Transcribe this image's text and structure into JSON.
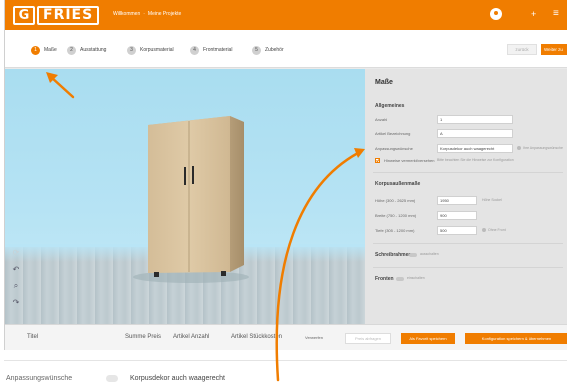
{
  "colors": {
    "accent": "#f07d00",
    "sky": "#b6e3f4",
    "floor": "#c3cfd4",
    "wood": "#dcc8a8"
  },
  "header": {
    "brand": "FRIES",
    "breadcrumb": [
      "Willkommen",
      "Meine Projekte"
    ],
    "icons": [
      "logo-icon",
      "avatar-icon",
      "plus-icon",
      "menu-icon"
    ]
  },
  "steps": [
    {
      "num": "1",
      "label": "Maße",
      "active": true
    },
    {
      "num": "2",
      "label": "Ausstattung",
      "active": false
    },
    {
      "num": "3",
      "label": "Korpusmaterial",
      "active": false
    },
    {
      "num": "4",
      "label": "Frontmaterial",
      "active": false
    },
    {
      "num": "5",
      "label": "Zubehör",
      "active": false
    }
  ],
  "nav": {
    "back_label": "zurück",
    "next_label": "Weiter zu"
  },
  "viewport_tools": [
    "rotate-icon",
    "undo-icon",
    "zoom-icon",
    "redo-icon"
  ],
  "panel": {
    "title": "Maße",
    "general": {
      "title": "Allgemeines",
      "anzahl_label": "Anzahl",
      "anzahl_value": "1",
      "artikel_label": "Artikel Bezeichnung",
      "artikel_value": "A",
      "anpassung_label": "Anpassungswünsche",
      "anpassung_value": "Korpusdekor auch waagerecht",
      "anpassung_hint": "Ihre Anpassungswünsche",
      "check_label": "Hinweise vermerkt/versehen",
      "check_hint": "Bitte beachten Sie die Hinweise zur Konfiguration"
    },
    "korpus": {
      "title": "Korpusaußenmaße",
      "hoehe_label": "Höhe (300 - 2625 mm)",
      "hoehe_value": "1950",
      "hoehe_hint": "Höhe Sockel",
      "breite_label": "Breite (750 - 1200 mm)",
      "breite_value": "900",
      "tiefe_label": "Tiefe (305 - 1200 mm)",
      "tiefe_value": "500",
      "tiefe_hint": "Ohne Front"
    },
    "schreibrahmen_label": "Schreibrahmen",
    "schreibrahmen_hint": "ausschalten",
    "fronten_label": "Fronten",
    "fronten_hint": "einschalten"
  },
  "footer": {
    "titel": "Titel",
    "summe": "Summe Preis",
    "anzahl": "Artikel Anzahl",
    "stueckkosten": "Artikel Stückkosten",
    "verwerfen": "Verwerfen",
    "btn_grey": "Preis abfragen",
    "btn_save": "Als Favorit speichern",
    "btn_save2": "Konfiguration speichern & übernehmen"
  },
  "below": {
    "label": "Anpassungswünsche",
    "value": "Korpusdekor auch waagerecht"
  }
}
